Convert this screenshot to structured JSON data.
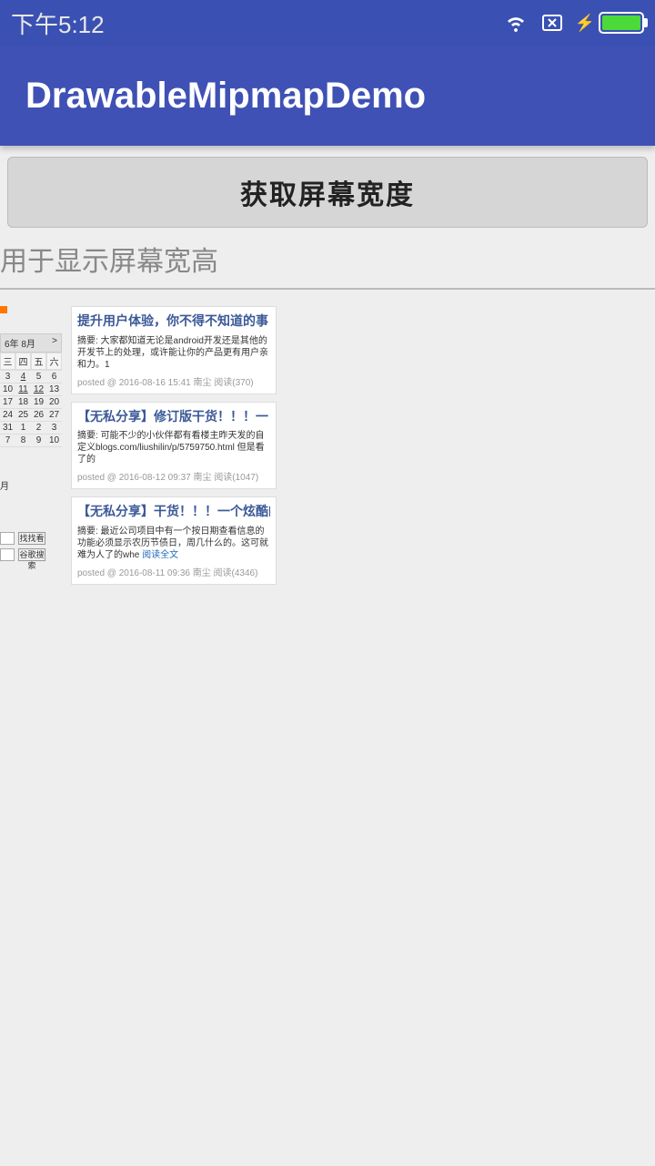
{
  "status": {
    "time": "下午5:12"
  },
  "app": {
    "title": "DrawableMipmapDemo"
  },
  "main": {
    "button_label": "获取屏幕宽度",
    "screen_label": "用于显示屏幕宽高"
  },
  "sidebar": {
    "cal_title": "6年 8月",
    "cal_nav": ">",
    "week_headers": [
      "三",
      "四",
      "五",
      "六"
    ],
    "rows": [
      [
        "3",
        "4",
        "5",
        "6"
      ],
      [
        "10",
        "11",
        "12",
        "13"
      ],
      [
        "17",
        "18",
        "19",
        "20"
      ],
      [
        "24",
        "25",
        "26",
        "27"
      ],
      [
        "31",
        "1",
        "2",
        "3"
      ],
      [
        "7",
        "8",
        "9",
        "10"
      ]
    ],
    "month_label": "月",
    "btn1": "找找看",
    "btn2": "谷歌搜索"
  },
  "posts": [
    {
      "title": "提升用户体验，你不得不知道的事",
      "summary": "摘要: 大家都知道无论是android开发还是其他的开发节上的处理，或许能让你的产品更有用户亲和力。1",
      "meta": "posted @ 2016-08-16 15:41 南尘 阅读(370)"
    },
    {
      "title": "【无私分享】修订版干货！！！一",
      "summary": "摘要: 可能不少的小伙伴都有看楼主昨天发的自定义blogs.com/liushilin/p/5759750.html 但是看了的",
      "meta": "posted @ 2016-08-12 09:37 南尘 阅读(1047)"
    },
    {
      "title": "【无私分享】干货！！！一个炫酷的",
      "summary": "摘要: 最近公司项目中有一个按日期查看信息的功能必须显示农历节债日，周几什么的。这可就难为人了的whe ",
      "summary_link": "阅读全文",
      "meta": "posted @ 2016-08-11 09:36 南尘 阅读(4346)"
    }
  ]
}
